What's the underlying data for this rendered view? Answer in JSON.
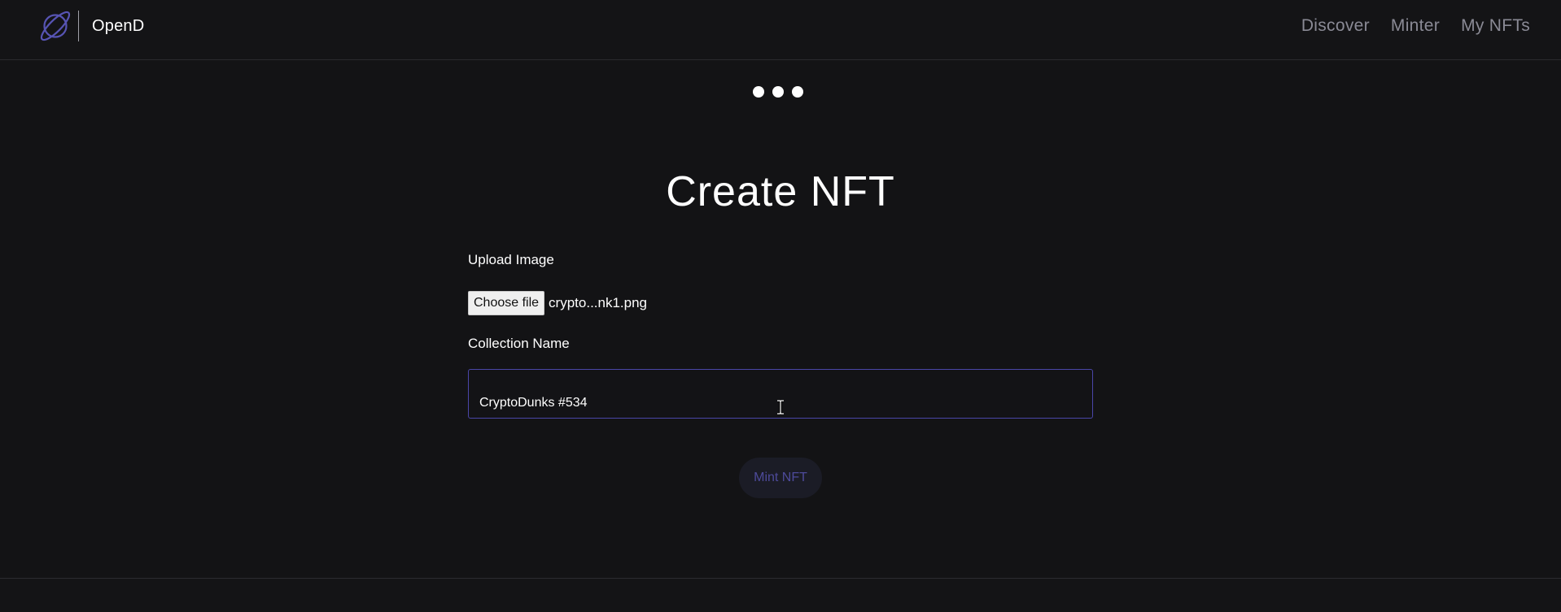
{
  "header": {
    "brand": "OpenD",
    "nav": [
      {
        "label": "Discover"
      },
      {
        "label": "Minter"
      },
      {
        "label": "My NFTs"
      }
    ]
  },
  "main": {
    "title": "Create NFT",
    "upload_label": "Upload Image",
    "choose_file_label": "Choose file",
    "file_name": "crypto...nk1.png",
    "collection_label": "Collection Name",
    "collection_value": "CryptoDunks #534",
    "mint_label": "Mint NFT"
  },
  "icons": {
    "logo": "planet-icon",
    "cursor": "text-cursor-icon",
    "loader": "loading-dots-icon"
  },
  "colors": {
    "background": "#131315",
    "accent": "#4d4a9a",
    "input_border": "#4a46a8",
    "nav_text": "#8a8a95"
  }
}
